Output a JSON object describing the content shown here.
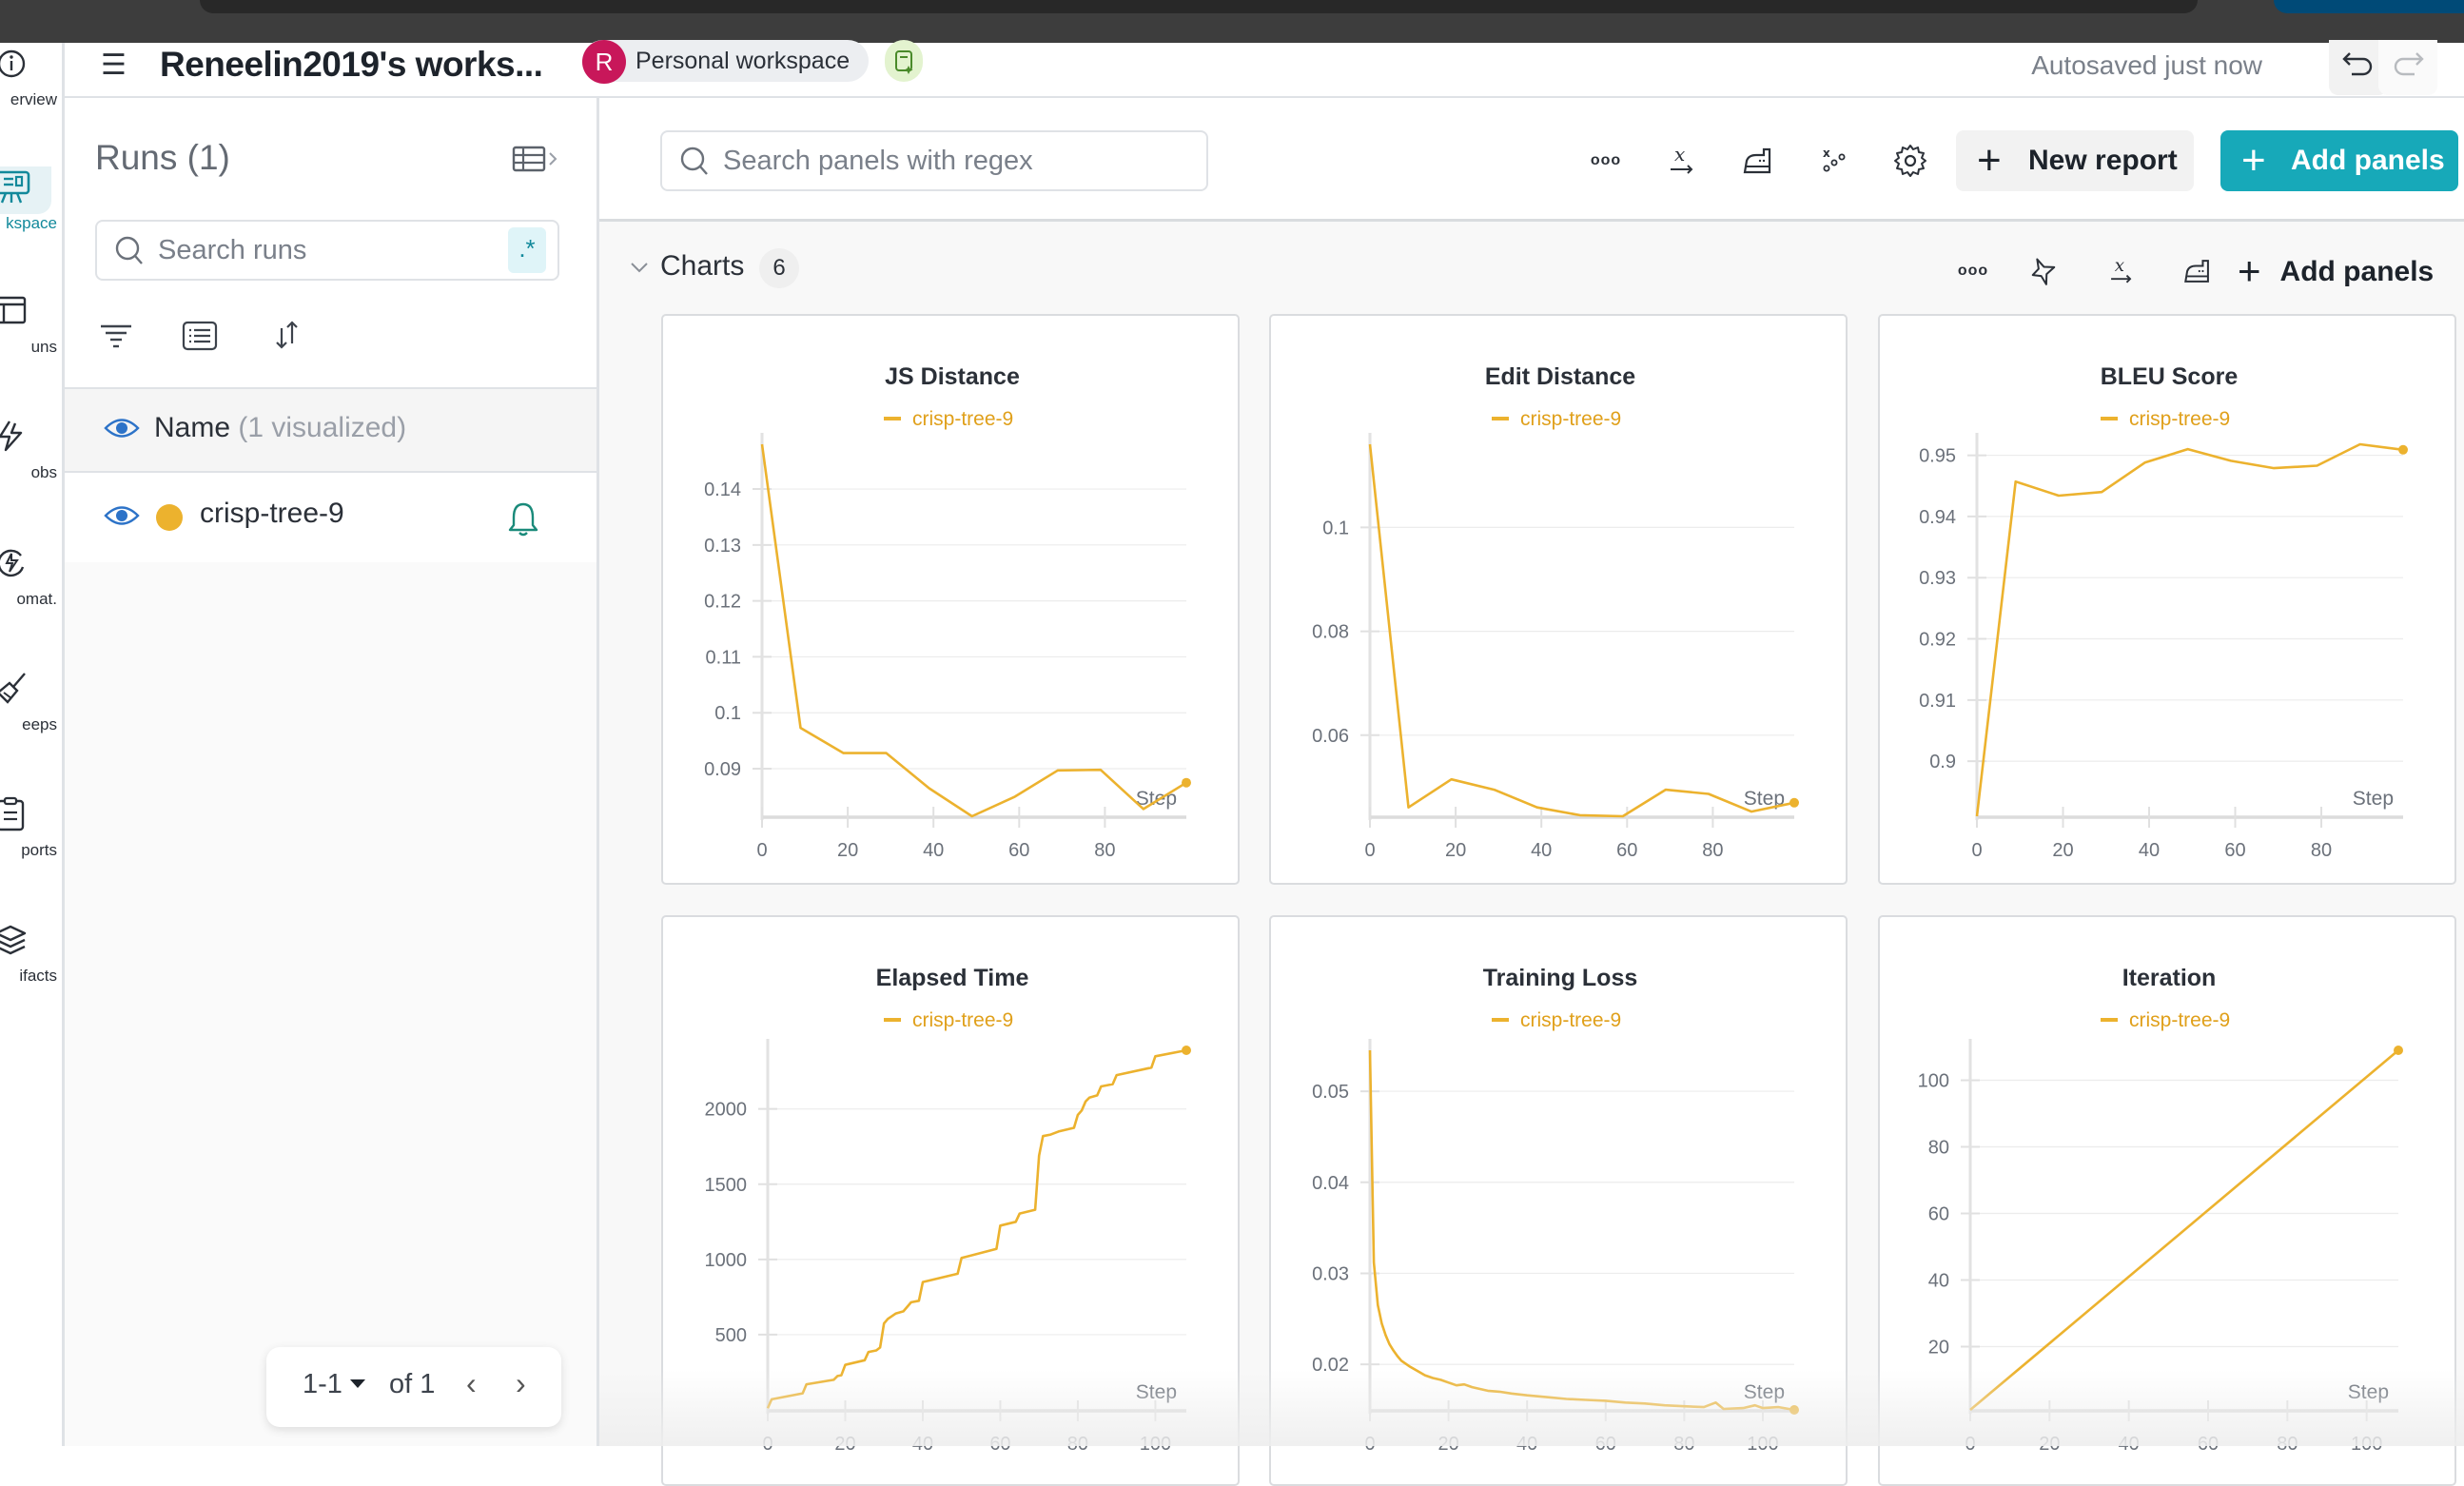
{
  "header": {
    "title": "Reneelin2019's works...",
    "workspace_avatar_letter": "R",
    "workspace_label": "Personal workspace",
    "autosave_status": "Autosaved just now"
  },
  "rail": {
    "items": [
      {
        "label": "erview",
        "icon": "info-icon",
        "active": false
      },
      {
        "label": "kspace",
        "icon": "workspace-icon",
        "active": true
      },
      {
        "label": "uns",
        "icon": "runs-table-icon",
        "active": false
      },
      {
        "label": "obs",
        "icon": "jobs-bolt-icon",
        "active": false
      },
      {
        "label": "omat.",
        "icon": "automations-icon",
        "active": false
      },
      {
        "label": "eeps",
        "icon": "sweeps-broom-icon",
        "active": false
      },
      {
        "label": "ports",
        "icon": "reports-clipboard-icon",
        "active": false
      },
      {
        "label": "ifacts",
        "icon": "artifacts-layers-icon",
        "active": false
      }
    ]
  },
  "sidebar": {
    "runs_title": "Runs (1)",
    "search_placeholder": "Search runs",
    "regex_label": ".*",
    "name_column": "Name",
    "name_column_sub": "(1 visualized)",
    "runs": [
      {
        "name": "crisp-tree-9",
        "color": "#ecb22e",
        "visible": true
      }
    ],
    "pager": {
      "range": "1-1",
      "of": "of 1"
    }
  },
  "toolbar": {
    "search_placeholder": "Search panels with regex",
    "new_report_label": "New report",
    "add_panels_label": "Add panels"
  },
  "section": {
    "title": "Charts",
    "count": "6",
    "add_panels_label": "Add panels"
  },
  "colors": {
    "accent": "#17a9b9",
    "run_color": "#ecb22e",
    "workspace_avatar": "#c8175a"
  },
  "chart_data": [
    {
      "type": "line",
      "title": "JS Distance",
      "xlabel": "Step",
      "ylabel": "",
      "legend": [
        "crisp-tree-9"
      ],
      "legend_position": "top-center",
      "xlim": [
        0,
        99
      ],
      "ylim": [
        0.0815,
        0.148
      ],
      "xticks": [
        0,
        20,
        40,
        60,
        80
      ],
      "yticks": [
        0.09,
        0.1,
        0.11,
        0.12,
        0.13,
        0.14
      ],
      "ytick_labels": [
        "0.09",
        "0.1",
        "0.11",
        "0.12",
        "0.13",
        "0.14"
      ],
      "grid": true,
      "series": [
        {
          "name": "crisp-tree-9",
          "x": [
            0,
            9,
            19,
            29,
            39,
            49,
            59,
            69,
            79,
            89,
            99
          ],
          "y": [
            0.148,
            0.0973,
            0.0928,
            0.0928,
            0.0865,
            0.0815,
            0.085,
            0.0897,
            0.0898,
            0.0828,
            0.0875
          ]
        }
      ]
    },
    {
      "type": "line",
      "title": "Edit Distance",
      "xlabel": "Step",
      "ylabel": "",
      "legend": [
        "crisp-tree-9"
      ],
      "legend_position": "top-center",
      "xlim": [
        0,
        99
      ],
      "ylim": [
        0.0444,
        0.116
      ],
      "xticks": [
        0,
        20,
        40,
        60,
        80
      ],
      "yticks": [
        0.06,
        0.08,
        0.1
      ],
      "ytick_labels": [
        "0.06",
        "0.08",
        "0.1"
      ],
      "grid": true,
      "series": [
        {
          "name": "crisp-tree-9",
          "x": [
            0,
            9,
            19,
            29,
            39,
            49,
            59,
            69,
            79,
            89,
            99
          ],
          "y": [
            0.116,
            0.0461,
            0.0515,
            0.0495,
            0.0461,
            0.0446,
            0.0444,
            0.0495,
            0.0487,
            0.0453,
            0.047
          ]
        }
      ]
    },
    {
      "type": "line",
      "title": "BLEU Score",
      "xlabel": "Step",
      "ylabel": "",
      "legend": [
        "crisp-tree-9"
      ],
      "legend_position": "top-center",
      "xlim": [
        0,
        99
      ],
      "ylim": [
        0.891,
        0.9518
      ],
      "xticks": [
        0,
        20,
        40,
        60,
        80
      ],
      "yticks": [
        0.9,
        0.91,
        0.92,
        0.93,
        0.94,
        0.95
      ],
      "ytick_labels": [
        "0.9",
        "0.91",
        "0.92",
        "0.93",
        "0.94",
        "0.95"
      ],
      "grid": true,
      "series": [
        {
          "name": "crisp-tree-9",
          "x": [
            0,
            9,
            19,
            29,
            39,
            49,
            59,
            69,
            79,
            89,
            99
          ],
          "y": [
            0.891,
            0.9457,
            0.9434,
            0.944,
            0.9488,
            0.951,
            0.9491,
            0.9479,
            0.9483,
            0.9518,
            0.9509
          ]
        }
      ]
    },
    {
      "type": "line",
      "title": "Elapsed Time",
      "xlabel": "Step",
      "ylabel": "",
      "legend": [
        "crisp-tree-9"
      ],
      "legend_position": "top-center",
      "xlim": [
        0,
        108
      ],
      "ylim": [
        0,
        2390
      ],
      "xticks": [
        0,
        20,
        40,
        60,
        80,
        100
      ],
      "yticks": [
        500,
        1000,
        1500,
        2000
      ],
      "ytick_labels": [
        "500",
        "1000",
        "1500",
        "2000"
      ],
      "grid": true,
      "series": [
        {
          "name": "crisp-tree-9",
          "x": [
            0,
            1,
            9,
            10,
            17,
            18,
            19,
            20,
            25,
            26,
            28,
            29,
            30,
            31,
            33,
            35,
            37,
            39,
            40,
            49,
            50,
            59,
            60,
            64,
            65,
            69,
            70,
            71,
            73,
            75,
            79,
            80,
            81,
            82,
            83,
            85,
            86,
            89,
            90,
            99,
            100,
            108
          ],
          "y": [
            11,
            70,
            110,
            170,
            200,
            225,
            230,
            300,
            330,
            385,
            395,
            415,
            575,
            605,
            640,
            655,
            715,
            725,
            850,
            905,
            1010,
            1070,
            1225,
            1250,
            1305,
            1330,
            1690,
            1820,
            1830,
            1850,
            1875,
            1960,
            1990,
            2050,
            2075,
            2090,
            2150,
            2165,
            2225,
            2275,
            2350,
            2390
          ]
        }
      ]
    },
    {
      "type": "line",
      "title": "Training Loss",
      "xlabel": "Step",
      "ylabel": "",
      "legend": [
        "crisp-tree-9"
      ],
      "legend_position": "top-center",
      "xlim": [
        0,
        108
      ],
      "ylim": [
        0.015,
        0.0545
      ],
      "xticks": [
        0,
        20,
        40,
        60,
        80,
        100
      ],
      "yticks": [
        0.02,
        0.03,
        0.04,
        0.05
      ],
      "ytick_labels": [
        "0.02",
        "0.03",
        "0.04",
        "0.05"
      ],
      "grid": true,
      "series": [
        {
          "name": "crisp-tree-9",
          "x": [
            0,
            1,
            2,
            3,
            4,
            5,
            6,
            7,
            8,
            10,
            12,
            14,
            16,
            18,
            20,
            22,
            24,
            26,
            28,
            30,
            33,
            36,
            40,
            45,
            50,
            55,
            60,
            65,
            70,
            75,
            80,
            85,
            88,
            90,
            95,
            98,
            100,
            104,
            108
          ],
          "y": [
            0.0545,
            0.0312,
            0.0265,
            0.0245,
            0.0232,
            0.0222,
            0.0215,
            0.0209,
            0.0204,
            0.0198,
            0.0193,
            0.0188,
            0.0185,
            0.0183,
            0.018,
            0.0177,
            0.0178,
            0.0175,
            0.0173,
            0.0171,
            0.017,
            0.0168,
            0.0166,
            0.0164,
            0.0162,
            0.0161,
            0.016,
            0.0158,
            0.0157,
            0.0155,
            0.0154,
            0.0153,
            0.0158,
            0.0151,
            0.0152,
            0.0155,
            0.0152,
            0.0153,
            0.015
          ]
        }
      ]
    },
    {
      "type": "line",
      "title": "Iteration",
      "xlabel": "Step",
      "ylabel": "",
      "legend": [
        "crisp-tree-9"
      ],
      "legend_position": "top-center",
      "xlim": [
        0,
        108
      ],
      "ylim": [
        1,
        109
      ],
      "xticks": [
        0,
        20,
        40,
        60,
        80,
        100
      ],
      "yticks": [
        20,
        40,
        60,
        80,
        100
      ],
      "ytick_labels": [
        "20",
        "40",
        "60",
        "80",
        "100"
      ],
      "grid": true,
      "series": [
        {
          "name": "crisp-tree-9",
          "x": [
            0,
            108
          ],
          "y": [
            1,
            109
          ]
        }
      ]
    }
  ]
}
